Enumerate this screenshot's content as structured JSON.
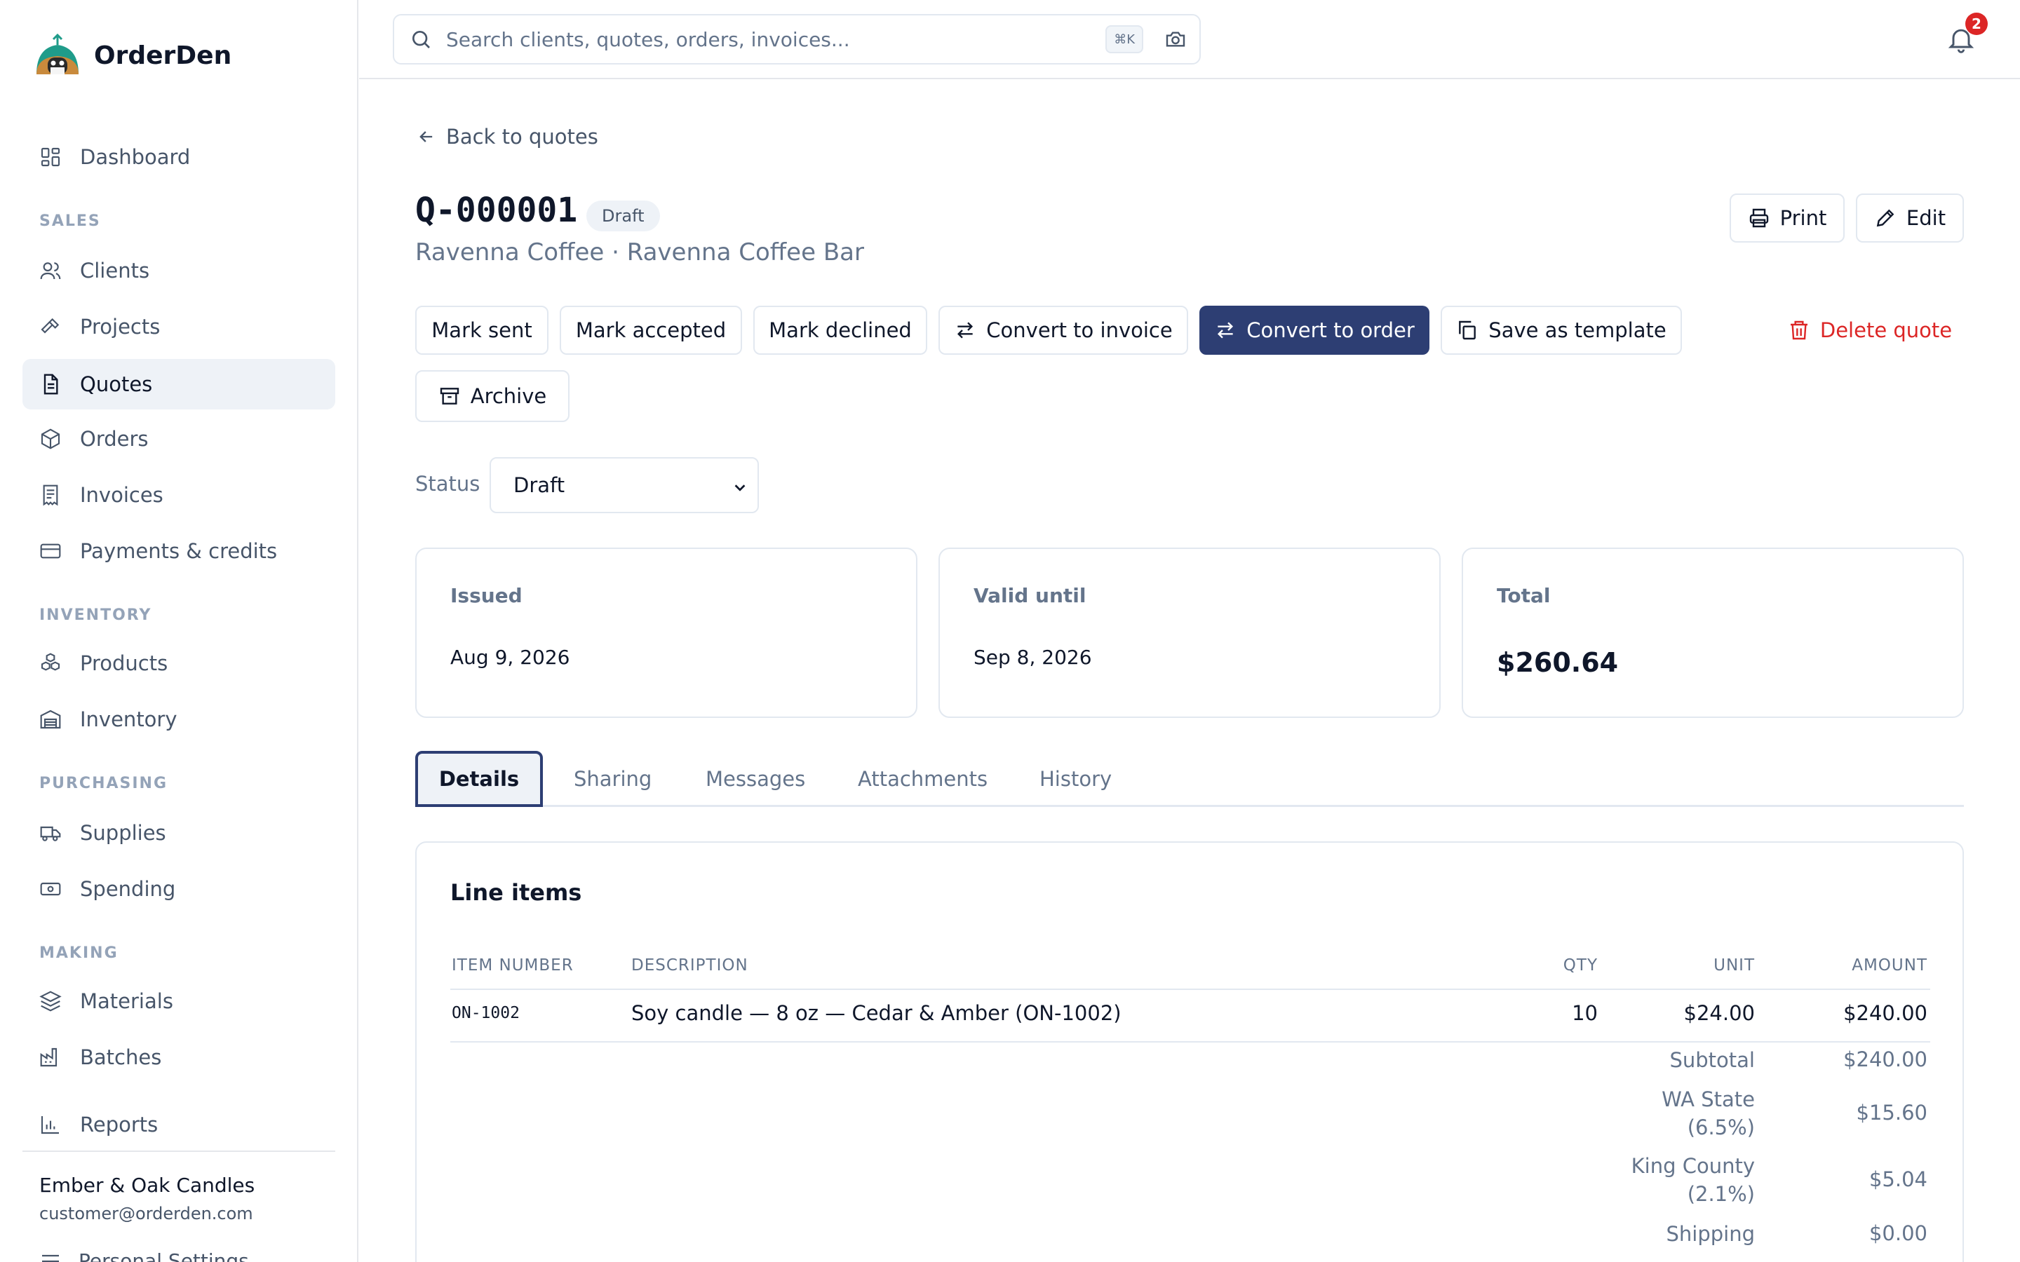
{
  "app": {
    "name": "OrderDen"
  },
  "nav": {
    "dashboard": "Dashboard",
    "sections": {
      "sales": "SALES",
      "inventory": "INVENTORY",
      "purchasing": "PURCHASING",
      "making": "MAKING"
    },
    "clients": "Clients",
    "projects": "Projects",
    "quotes": "Quotes",
    "orders": "Orders",
    "invoices": "Invoices",
    "payments": "Payments & credits",
    "products": "Products",
    "inventory": "Inventory",
    "supplies": "Supplies",
    "spending": "Spending",
    "materials": "Materials",
    "batches": "Batches",
    "reports": "Reports",
    "personal_settings": "Personal Settings"
  },
  "account": {
    "name": "Ember & Oak Candles",
    "email": "customer@orderden.com"
  },
  "search": {
    "placeholder": "Search clients, quotes, orders, invoices...",
    "shortcut": "⌘K"
  },
  "notifications": {
    "count": "2"
  },
  "quote": {
    "back_label": "Back to quotes",
    "number": "Q-000001",
    "status_badge": "Draft",
    "subtitle": "Ravenna Coffee · Ravenna Coffee Bar",
    "actions": {
      "print": "Print",
      "edit": "Edit",
      "mark_sent": "Mark sent",
      "mark_accepted": "Mark accepted",
      "mark_declined": "Mark declined",
      "convert_invoice": "Convert to invoice",
      "convert_order": "Convert to order",
      "save_template": "Save as template",
      "delete": "Delete quote",
      "archive": "Archive"
    },
    "status_label": "Status",
    "status_value": "Draft",
    "cards": {
      "issued_label": "Issued",
      "issued_value": "Aug 9, 2026",
      "valid_label": "Valid until",
      "valid_value": "Sep 8, 2026",
      "total_label": "Total",
      "total_value": "$260.64"
    },
    "tabs": [
      "Details",
      "Sharing",
      "Messages",
      "Attachments",
      "History"
    ],
    "line_items": {
      "title": "Line items",
      "headers": {
        "item_number": "ITEM NUMBER",
        "description": "DESCRIPTION",
        "qty": "QTY",
        "unit": "UNIT",
        "amount": "AMOUNT"
      },
      "rows": [
        {
          "item_number": "ON-1002",
          "description": "Soy candle — 8 oz — Cedar & Amber (ON-1002)",
          "qty": "10",
          "unit": "$24.00",
          "amount": "$240.00"
        }
      ],
      "summary": [
        {
          "label": "Subtotal",
          "value": "$240.00"
        },
        {
          "label_line1": "WA State",
          "label_line2": "(6.5%)",
          "value": "$15.60"
        },
        {
          "label_line1": "King County",
          "label_line2": "(2.1%)",
          "value": "$5.04"
        },
        {
          "label": "Shipping",
          "value": "$0.00"
        }
      ]
    }
  },
  "colors": {
    "primary": "#2d3e73",
    "danger": "#dc2626",
    "active_nav_bg": "#eef2f7",
    "muted_text": "#64748b"
  }
}
